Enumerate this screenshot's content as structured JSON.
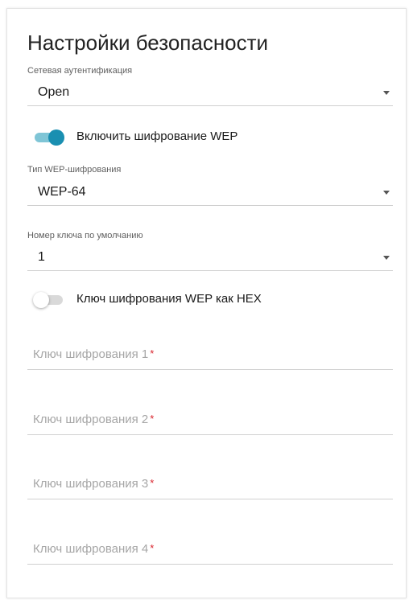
{
  "title": "Настройки безопасности",
  "auth": {
    "label": "Сетевая аутентификация",
    "value": "Open"
  },
  "wep_toggle": {
    "label": "Включить шифрование WEP",
    "state": "on"
  },
  "wep_type": {
    "label": "Тип WEP-шифрования",
    "value": "WEP-64"
  },
  "default_key": {
    "label": "Номер ключа по умолчанию",
    "value": "1"
  },
  "hex_toggle": {
    "label": "Ключ шифрования WEP как HEX",
    "state": "off"
  },
  "keys": [
    {
      "placeholder": "Ключ шифрования 1",
      "required_mark": "*"
    },
    {
      "placeholder": "Ключ шифрования 2",
      "required_mark": "*"
    },
    {
      "placeholder": "Ключ шифрования 3",
      "required_mark": "*"
    },
    {
      "placeholder": "Ключ шифрования 4",
      "required_mark": "*"
    }
  ],
  "colors": {
    "accent": "#1a8fb1",
    "accent_track": "#7fc5d6",
    "required": "#d9252e"
  },
  "icons": {
    "dropdown": "caret-down-icon"
  }
}
